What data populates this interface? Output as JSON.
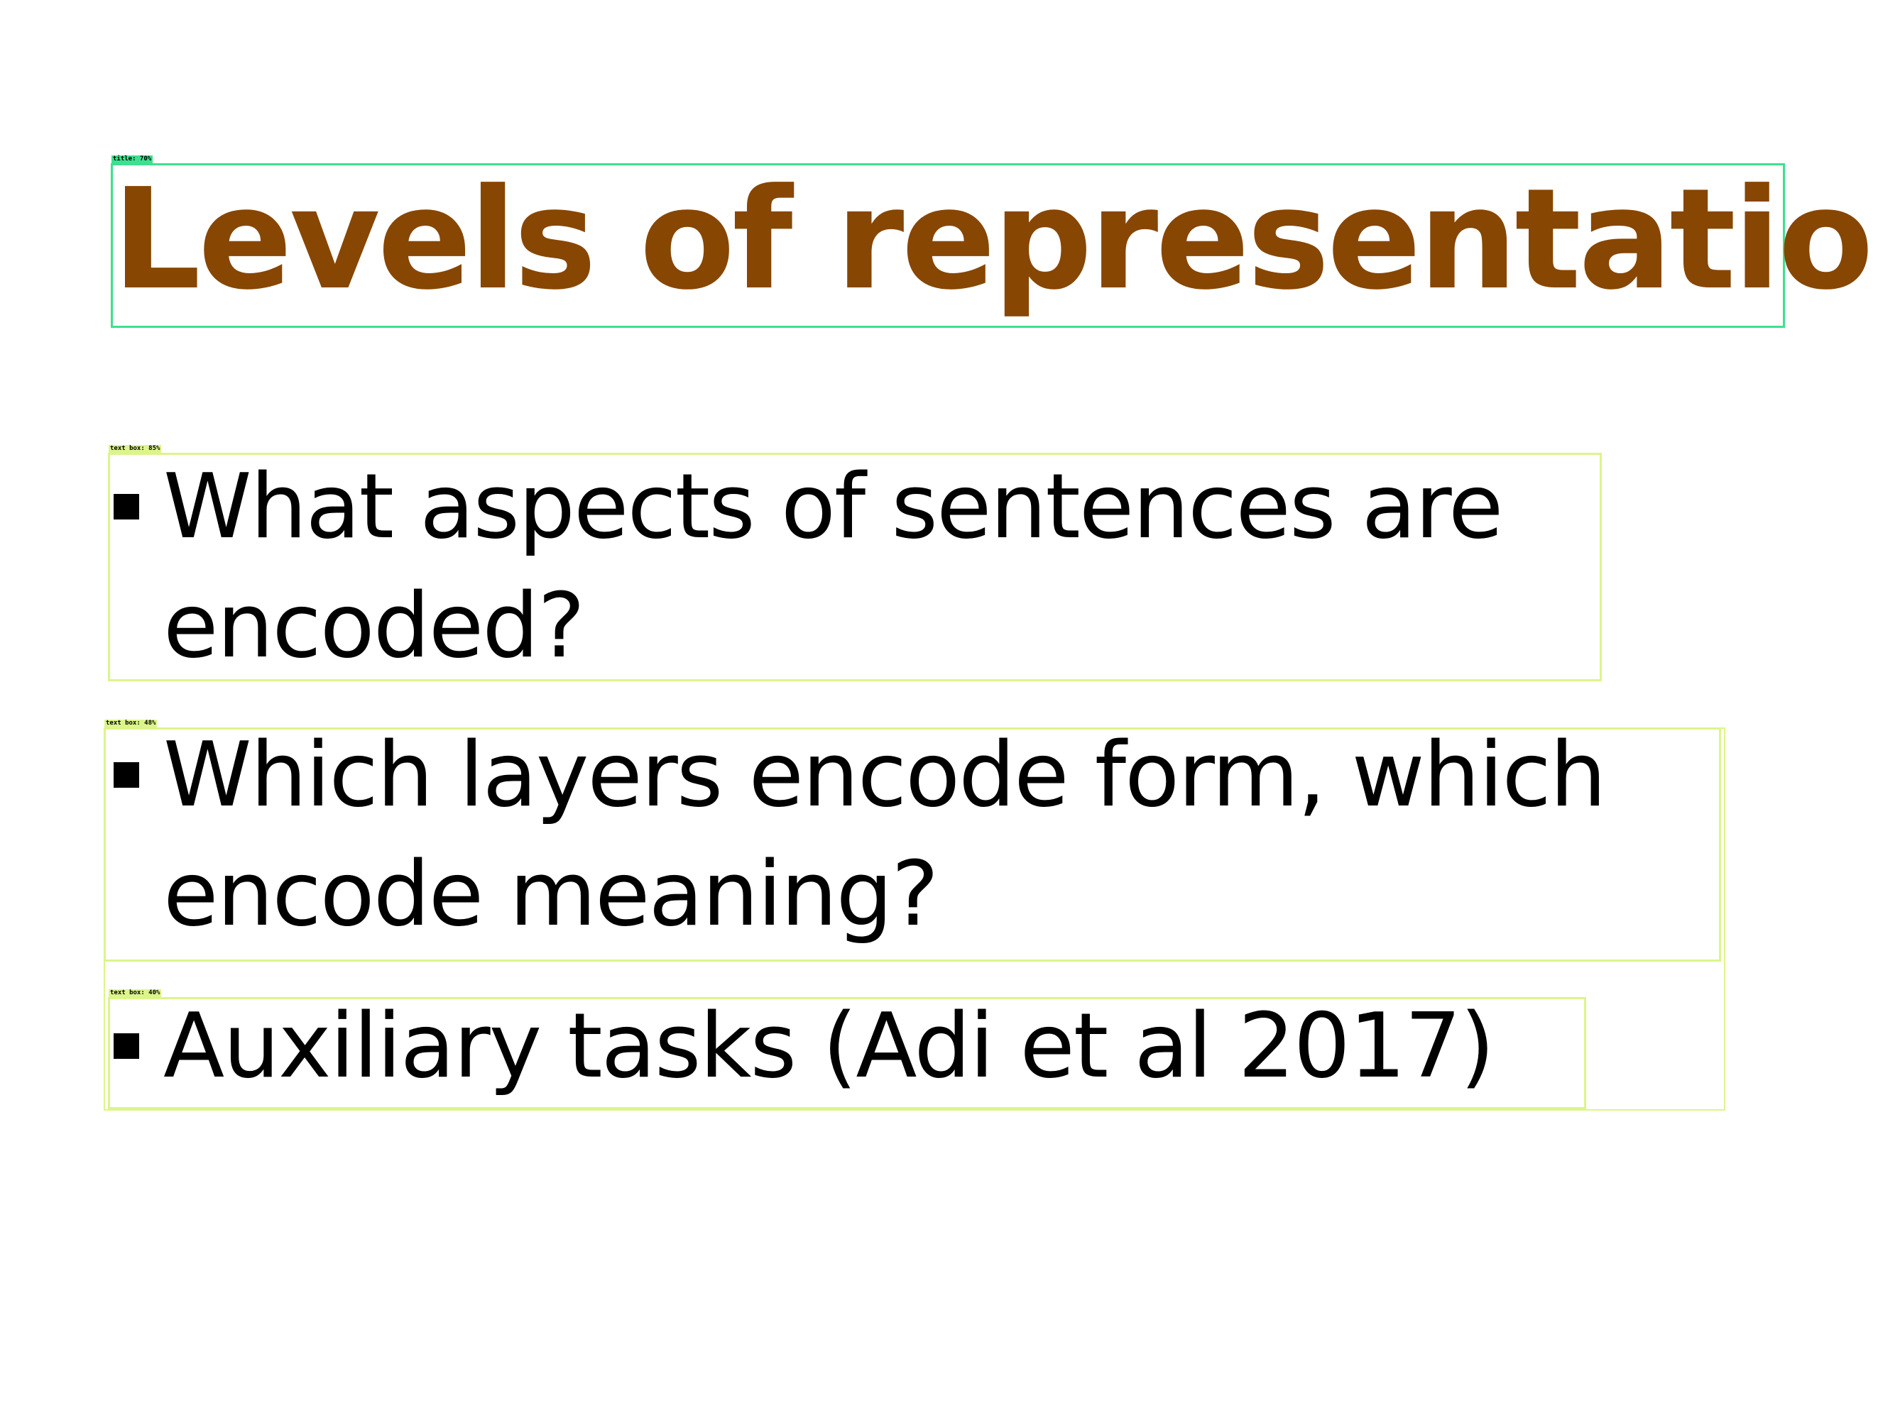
{
  "slide": {
    "title": "Levels of representation",
    "bullets": [
      {
        "lines": [
          "What aspects of sentences are",
          "encoded?"
        ]
      },
      {
        "lines": [
          "Which layers encode form, which",
          "encode meaning?"
        ]
      },
      {
        "lines": [
          "Auxiliary tasks (Adi et al 2017)"
        ]
      }
    ]
  },
  "annotations": {
    "title_label": "title: 70%",
    "box1_label": "text box: 85%",
    "box2_label": "text box: 48%",
    "box3_label": "text box: 40%"
  },
  "colors": {
    "title": "#874602",
    "title_box": "#3ee08f",
    "text_box": "#dcf58a"
  }
}
